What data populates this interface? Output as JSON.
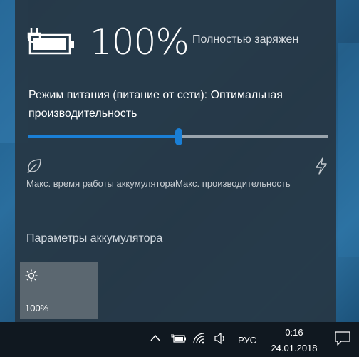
{
  "battery": {
    "percent": "100%",
    "status": "Полностью заряжен"
  },
  "power_mode": {
    "text": "Режим питания (питание от сети): Оптимальная производительность",
    "slider_level": 0.5,
    "label_left": "Макс. время работы аккумулятора",
    "label_right": "Макс. производительность"
  },
  "settings_link": "Параметры аккумулятора",
  "brightness": {
    "value": "100%"
  },
  "taskbar": {
    "language": "РУС",
    "time": "0:16",
    "date": "24.01.2018"
  },
  "colors": {
    "accent": "#1a7fd6",
    "flyout_bg": "#263745",
    "taskbar_bg": "#101820"
  },
  "icons": [
    "plug-battery-icon",
    "leaf-icon",
    "bolt-icon",
    "sun-icon",
    "chevron-up-icon",
    "battery-icon",
    "wifi-icon",
    "volume-icon",
    "notification-icon"
  ]
}
